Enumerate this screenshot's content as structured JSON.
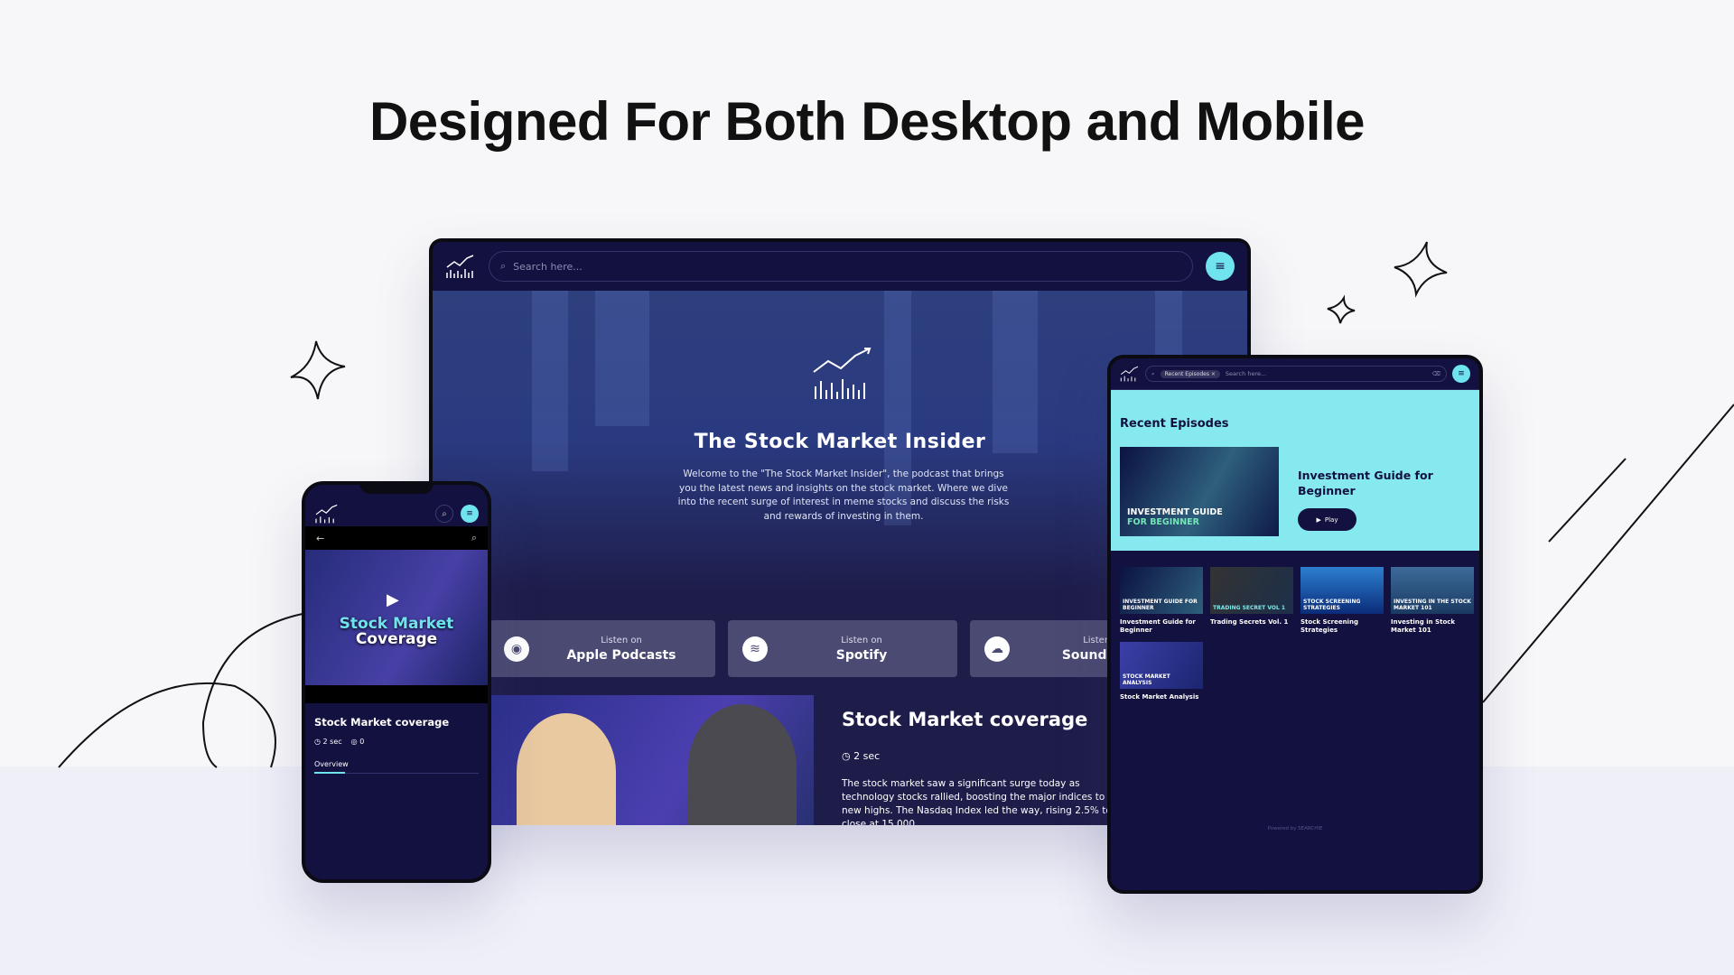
{
  "headline": "Designed For Both Desktop and Mobile",
  "colors": {
    "navy": "#13113f",
    "accent": "#6fe3ee",
    "cyan_section": "#86e9f0",
    "button": "#4a4a73"
  },
  "desktop": {
    "search_placeholder": "Search here...",
    "hero_title": "The Stock Market Insider",
    "hero_desc": "Welcome to the \"The Stock Market Insider\", the podcast that brings you the latest news and insights on the stock market.  Where we dive into the recent surge of interest in meme stocks and discuss the risks and rewards of investing in them.",
    "platforms": [
      {
        "prefix": "Listen on",
        "name": "Apple Podcasts",
        "icon": "podcast-icon"
      },
      {
        "prefix": "Listen on",
        "name": "Spotify",
        "icon": "spotify-icon"
      },
      {
        "prefix": "Listen on",
        "name": "Soundcloud",
        "icon": "soundcloud-icon"
      }
    ],
    "episode": {
      "title": "Stock Market coverage",
      "duration": "2 sec",
      "description": "The stock market saw a significant surge today as technology stocks rallied, boosting the major indices to new highs. The Nasdaq Index led the way, rising 2.5% to close at 15,000."
    }
  },
  "phone": {
    "video_line1": "Stock Market",
    "video_line2": "Coverage",
    "title": "Stock Market coverage",
    "duration": "2 sec",
    "comments": "0",
    "tab": "Overview"
  },
  "tablet": {
    "chip": "Recent Episodes",
    "search_placeholder": "Search here...",
    "section_title": "Recent Episodes",
    "featured": {
      "title": "Investment Guide for Beginner",
      "thumb_line1": "INVESTMENT GUIDE",
      "thumb_line2": "FOR BEGINNER",
      "play": "Play"
    },
    "episodes": [
      {
        "label": "Investment Guide for Beginner",
        "thumb": "INVESTMENT GUIDE FOR BEGINNER"
      },
      {
        "label": "Trading Secrets Vol. 1",
        "thumb": "TRADING SECRET VOL 1"
      },
      {
        "label": "Stock Screening Strategies",
        "thumb": "STOCK SCREENING STRATEGIES"
      },
      {
        "label": "Investing in Stock Market 101",
        "thumb": "INVESTING IN THE STOCK MARKET 101"
      },
      {
        "label": "Stock Market Analysis",
        "thumb": "STOCK MARKET ANALYSIS"
      }
    ],
    "powered": "Powered by SEARCHIE"
  }
}
